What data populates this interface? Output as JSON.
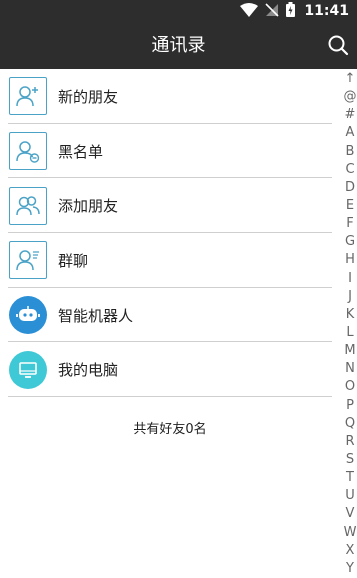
{
  "status_bar": {
    "time": "11:41"
  },
  "header": {
    "title": "通讯录"
  },
  "contacts": [
    {
      "label": "新的朋友",
      "icon": "new-friend-icon"
    },
    {
      "label": "黑名单",
      "icon": "blacklist-icon"
    },
    {
      "label": "添加朋友",
      "icon": "add-friend-icon"
    },
    {
      "label": "群聊",
      "icon": "group-chat-icon"
    },
    {
      "label": "智能机器人",
      "icon": "robot-icon"
    },
    {
      "label": "我的电脑",
      "icon": "computer-icon"
    }
  ],
  "footer": {
    "count_text": "共有好友0名"
  },
  "index_letters": [
    "↑",
    "@",
    "#",
    "A",
    "B",
    "C",
    "D",
    "E",
    "F",
    "G",
    "H",
    "I",
    "J",
    "K",
    "L",
    "M",
    "N",
    "O",
    "P",
    "Q",
    "R",
    "S",
    "T",
    "U",
    "V",
    "W",
    "X",
    "Y"
  ],
  "colors": {
    "header_bg": "#2d2d2d",
    "icon_blue": "#4aa3c7",
    "robot_bg": "#2b8fd6",
    "computer_bg": "#3fc8d6"
  }
}
